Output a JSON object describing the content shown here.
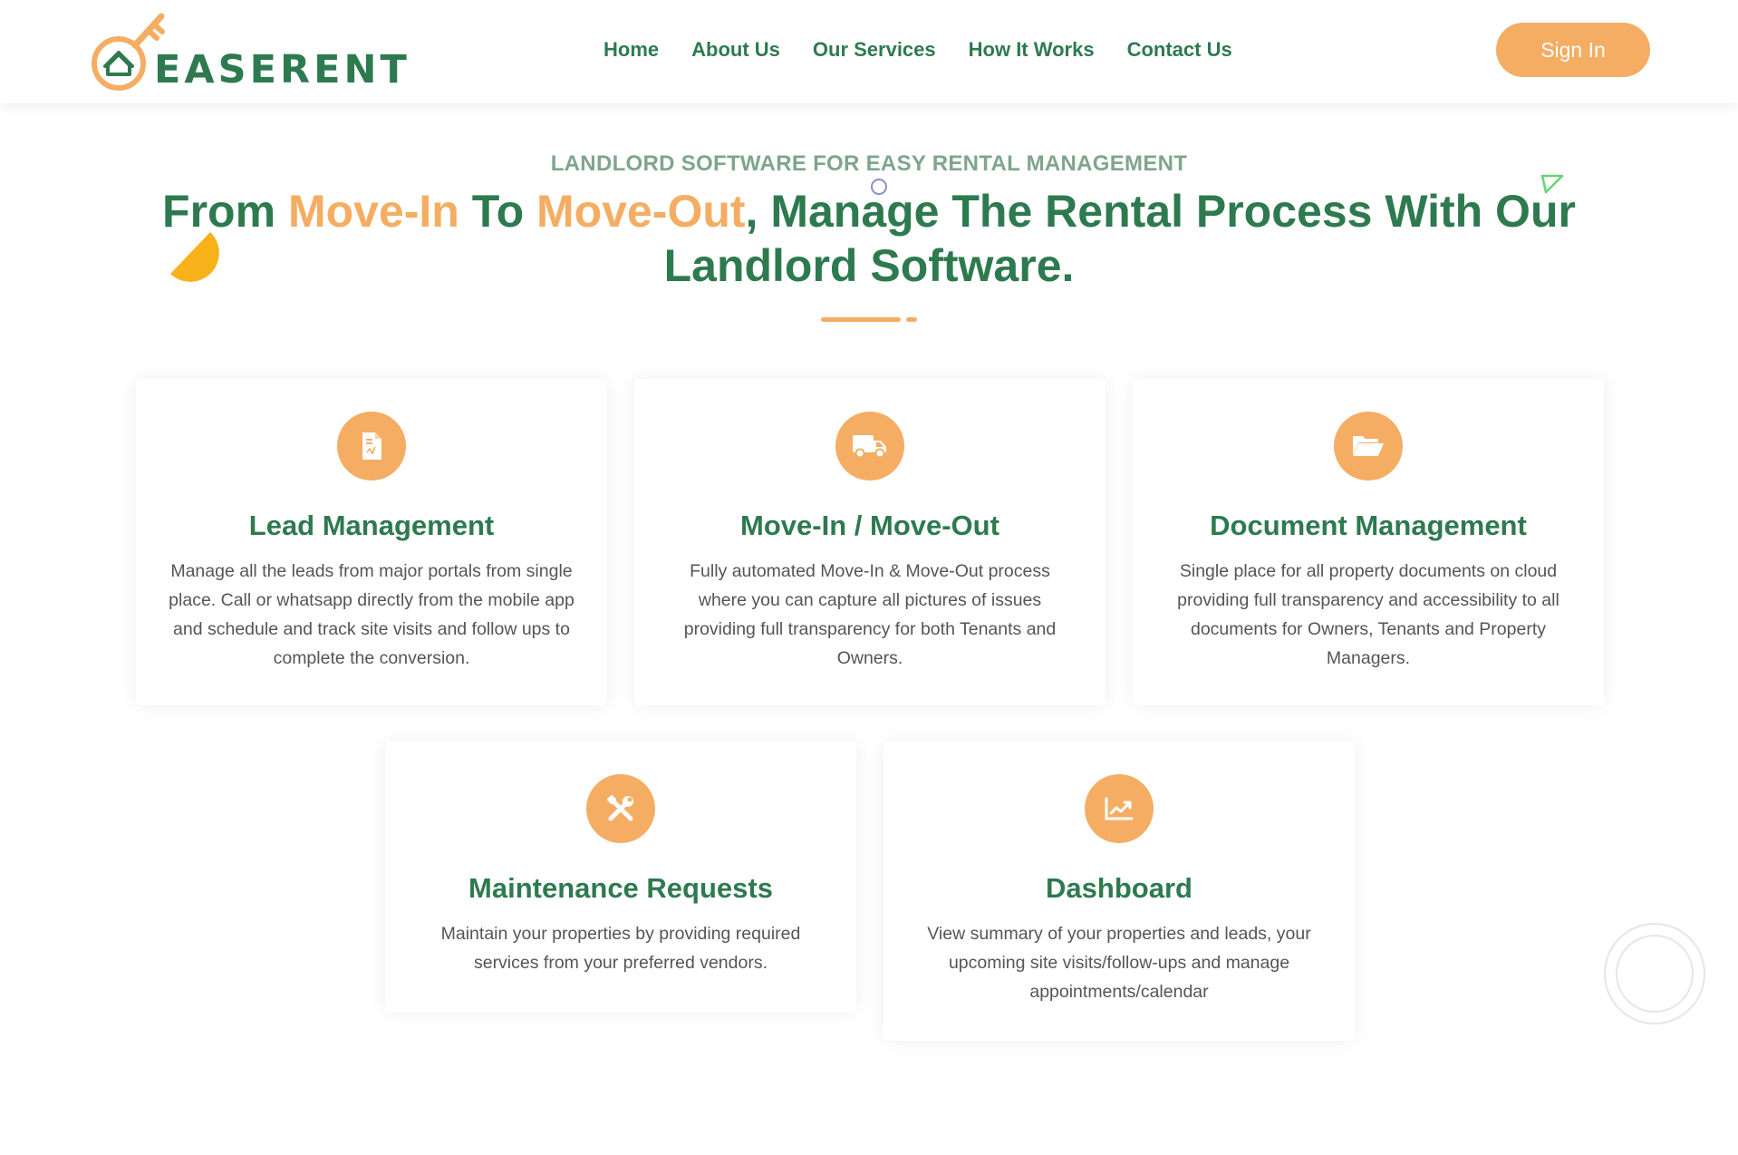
{
  "brand": {
    "name": "EASERENT",
    "primary_color": "#2e7a4f",
    "accent_color": "#f4ad63"
  },
  "nav": {
    "items": [
      "Home",
      "About Us",
      "Our Services",
      "How It Works",
      "Contact Us"
    ],
    "signin_label": "Sign In"
  },
  "hero": {
    "eyebrow": "LANDLORD SOFTWARE FOR EASY RENTAL MANAGEMENT",
    "headline_parts": {
      "p1": "From ",
      "h1": "Move-In",
      "p2": " To ",
      "h2": "Move-Out",
      "p3": ", Manage The Rental Process With Our Landlord Software."
    }
  },
  "features": [
    {
      "icon": "document-icon",
      "title": "Lead Management",
      "description": "Manage all the leads from major portals from single place. Call or whatsapp directly from the mobile app and schedule and track site visits and follow ups to complete the conversion."
    },
    {
      "icon": "truck-icon",
      "title": "Move-In / Move-Out",
      "description": "Fully automated Move-In & Move-Out process where you can capture all pictures of issues providing full transparency for both Tenants and Owners."
    },
    {
      "icon": "folder-open-icon",
      "title": "Document Management",
      "description": "Single place for all property documents on cloud providing full transparency and accessibility to all documents for Owners, Tenants and Property Managers."
    },
    {
      "icon": "tools-icon",
      "title": "Maintenance Requests",
      "description": "Maintain your properties by providing required services from your preferred vendors."
    },
    {
      "icon": "chart-line-icon",
      "title": "Dashboard",
      "description": "View summary of your properties and leads, your upcoming site visits/follow-ups and manage appointments/calendar"
    }
  ]
}
